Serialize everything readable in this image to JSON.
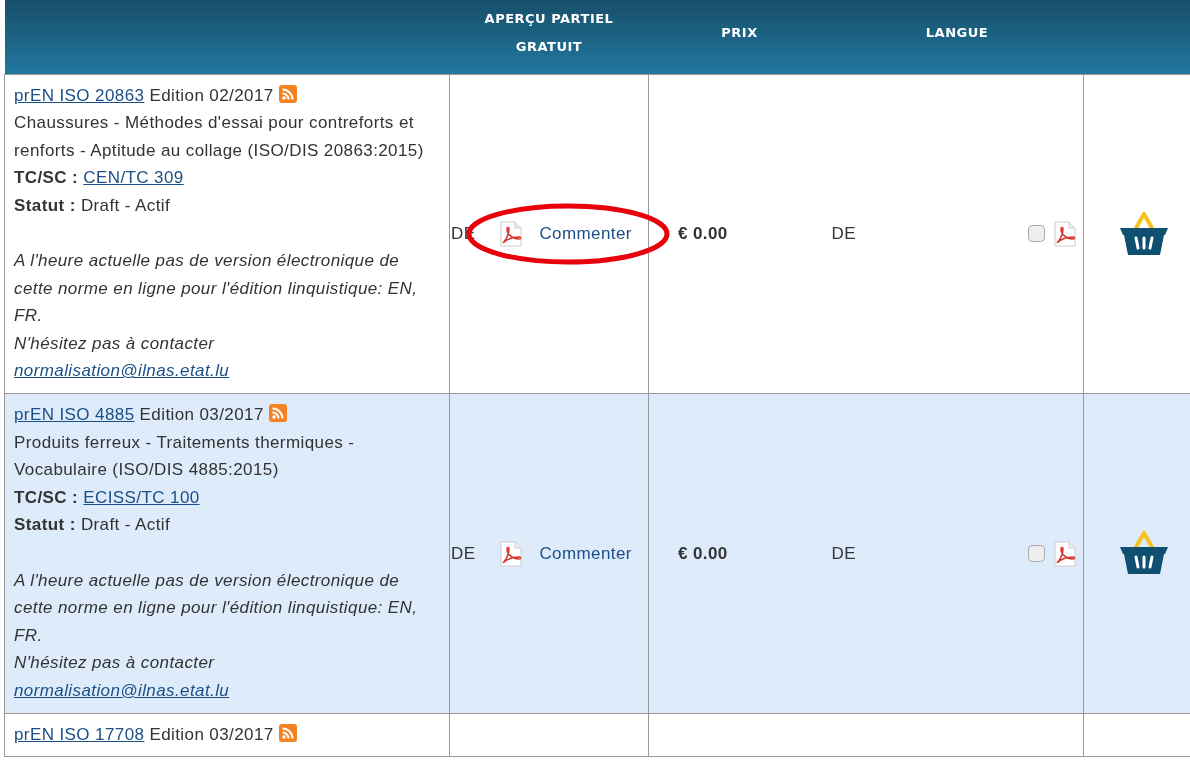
{
  "columns": [
    "APERÇU PARTIEL GRATUIT",
    "PRIX",
    "LANGUE"
  ],
  "rows": [
    {
      "code": "prEN ISO 20863",
      "edition": "Edition 02/2017",
      "title": "Chaussures - Méthodes d'essai pour contreforts et renforts - Aptitude au collage (ISO/DIS 20863:2015)",
      "tc_label": "TC/SC :",
      "tc": "CEN/TC 309",
      "status_label": "Statut :",
      "status": "Draft - Actif",
      "note": "A l'heure actuelle pas de version électronique de cette norme en ligne pour l'édition linquistique: EN, FR.",
      "contact": "N'hésitez pas à contacter",
      "email": "normalisation@ilnas.etat.lu",
      "preview_lang": "DE",
      "comment": "Commenter",
      "price": "€ 0.00",
      "language": "DE",
      "checked": false,
      "highlighted": true,
      "selected": false
    },
    {
      "code": "prEN ISO 4885",
      "edition": "Edition 03/2017",
      "title": "Produits ferreux - Traitements thermiques - Vocabulaire (ISO/DIS 4885:2015)",
      "tc_label": "TC/SC :",
      "tc": "ECISS/TC 100",
      "status_label": "Statut :",
      "status": "Draft - Actif",
      "note": "A l'heure actuelle pas de version électronique de cette norme en ligne pour l'édition linquistique: EN, FR.",
      "contact": "N'hésitez pas à contacter",
      "email": "normalisation@ilnas.etat.lu",
      "preview_lang": "DE",
      "comment": "Commenter",
      "price": "€ 0.00",
      "language": "DE",
      "checked": false,
      "highlighted": false,
      "selected": true
    },
    {
      "code": "prEN ISO 17708",
      "edition": "Edition 03/2017",
      "selected": false
    }
  ]
}
